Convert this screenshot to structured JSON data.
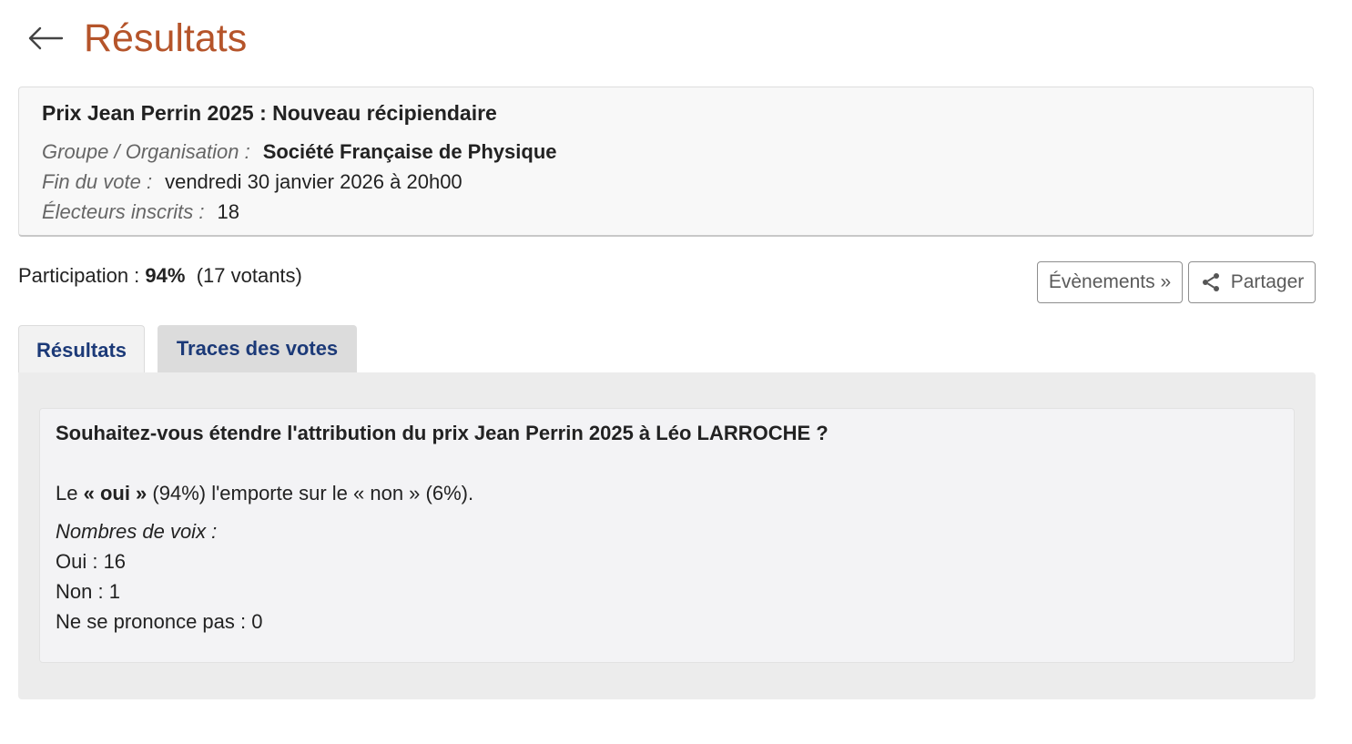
{
  "header": {
    "back_icon": "arrow-left-icon",
    "title": "Résultats"
  },
  "vote": {
    "title": "Prix Jean Perrin 2025 : Nouveau récipiendaire",
    "group_label": "Groupe / Organisation :",
    "group_value": "Société Française de Physique",
    "end_label": "Fin du vote :",
    "end_value": "vendredi 30 janvier 2026 à 20h00",
    "voters_label": "Électeurs inscrits :",
    "voters_value": "18"
  },
  "participation": {
    "label": "Participation :",
    "percent": "94%",
    "votants": "(17 votants)"
  },
  "actions": {
    "events_label": "Évènements »",
    "share_label": "Partager",
    "share_icon": "share-icon"
  },
  "tabs": [
    {
      "label": "Résultats",
      "active": true
    },
    {
      "label": "Traces des votes",
      "active": false
    }
  ],
  "result": {
    "question": "Souhaitez-vous étendre l'attribution du prix Jean Perrin 2025 à Léo LARROCHE ?",
    "summary_prefix": "Le ",
    "summary_winner": "« oui »",
    "summary_rest": " (94%) l'emporte sur le « non » (6%).",
    "counts_title": "Nombres de voix :",
    "counts": [
      {
        "label": "Oui : 16"
      },
      {
        "label": "Non : 1"
      },
      {
        "label": "Ne se prononce pas : 0"
      }
    ]
  }
}
